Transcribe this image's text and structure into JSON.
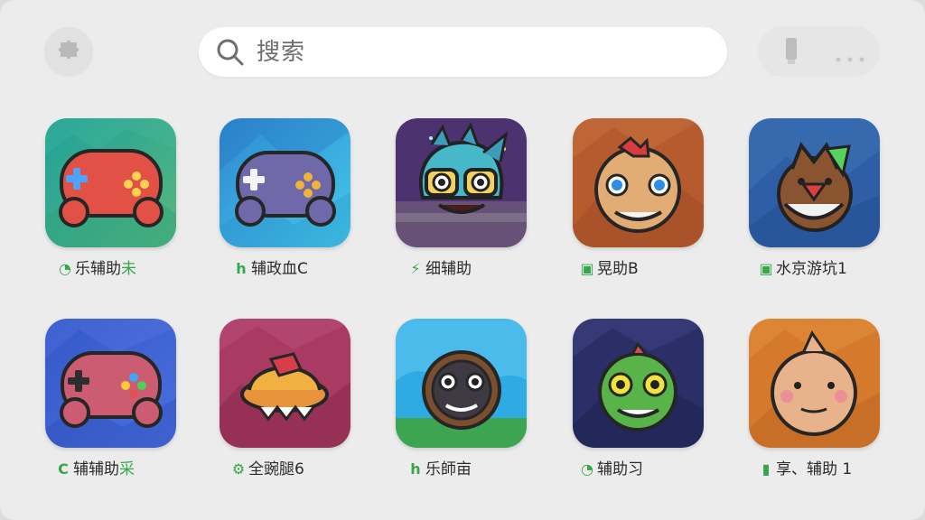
{
  "search": {
    "placeholder": "搜索"
  },
  "apps": [
    {
      "label": "乐辅助",
      "suffix": "未",
      "icon": "controller-icon",
      "badge_icon": "leaf-icon"
    },
    {
      "label": "辅政血C",
      "suffix": "",
      "icon": "controller-icon",
      "badge_icon": "h-icon"
    },
    {
      "label": "细辅助",
      "suffix": "",
      "icon": "monster-face-icon",
      "badge_icon": "bolt-icon"
    },
    {
      "label": "晃助B",
      "suffix": "",
      "icon": "face-icon",
      "badge_icon": "square-icon"
    },
    {
      "label": "水京游坑1",
      "suffix": "",
      "icon": "creature-icon",
      "badge_icon": "square-icon"
    },
    {
      "label": "辅辅助",
      "suffix": "采",
      "icon": "controller-icon",
      "badge_icon": "c-icon"
    },
    {
      "label": "全豌腿6",
      "suffix": "",
      "icon": "cake-icon",
      "badge_icon": "gear-icon"
    },
    {
      "label": "乐師亩",
      "suffix": "",
      "icon": "monster-face-icon",
      "badge_icon": "h-icon"
    },
    {
      "label": "辅助习",
      "suffix": "",
      "icon": "zombie-face-icon",
      "badge_icon": "leaf-icon"
    },
    {
      "label": "享、辅助 1",
      "suffix": "",
      "icon": "baby-face-icon",
      "badge_icon": "bar-chart-icon"
    }
  ],
  "colors": {
    "background": "#ececec",
    "accent_green": "#35a84a"
  }
}
